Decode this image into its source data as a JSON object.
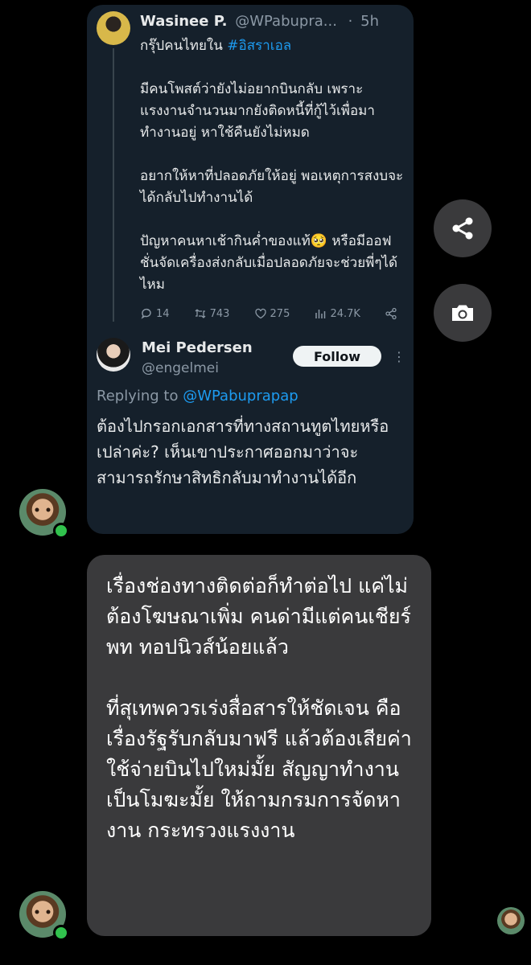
{
  "quoted_tweet": {
    "author_name": "Wasinee P.",
    "author_handle": "@WPabupra...",
    "time_sep": "·",
    "time": "5h",
    "body_line1_prefix": "กรุ๊ปคนไทยใน ",
    "body_line1_hashtag": "#อิสราเอล",
    "paragraphs": [
      "มีคนโพสต์ว่ายังไม่อยากบินกลับ เพราะแรงงานจำนวนมากยังติดหนี้ที่กู้ไว้เพื่อมาทำงานอยู่ หาใช้คืนยังไม่หมด",
      "อยากให้หาที่ปลอดภัยให้อยู่ พอเหตุการสงบจะได้กลับไปทำงานได้",
      "ปัญหาคนหาเช้ากินค่ำของแท้🥺 หรือมีออฟชั่นจัดเครื่องส่งกลับเมื่อปลอดภัยจะช่วยพี่ๆได้ไหม"
    ],
    "stats": {
      "replies": "14",
      "retweets": "743",
      "likes": "275",
      "views": "24.7K"
    }
  },
  "reply_tweet": {
    "author_name": "Mei Pedersen",
    "author_handle": "@engelmei",
    "follow_label": "Follow",
    "replying_prefix": "Replying to ",
    "replying_mention": "@WPabuprapap",
    "body": "ต้องไปกรอกเอกสารที่ทางสถานทูตไทยหรือเปล่าค่ะ? เห็นเขาประกาศออกมาว่าจะสามารถรักษาสิทธิกลับมาทำงานได้อีก"
  },
  "message": {
    "text": "เรื่องช่องทางติดต่อก็ทำต่อไป แค่ไม่ต้องโฆษณาเพิ่ม คนด่ามีแต่คนเชียร์พท ทอปนิวส์น้อยแล้ว\n\nที่สุเทพควรเร่งสื่อสารให้ชัดเจน คือเรื่องรัฐรับกลับมาฟรี แล้วต้องเสียค่าใช้จ่ายบินไปใหม่มั้ย สัญญาทำงานเป็นโมฆะมั้ย ให้ถามกรมการจัดหางาน กระทรวงแรงงาน"
  },
  "icons": {
    "share": "share-icon",
    "camera": "camera-icon"
  },
  "colors": {
    "tweet_bg": "#15202b",
    "link_blue": "#1d9bf0",
    "bubble_bg": "#3a3a3c",
    "online_green": "#31c24d"
  }
}
